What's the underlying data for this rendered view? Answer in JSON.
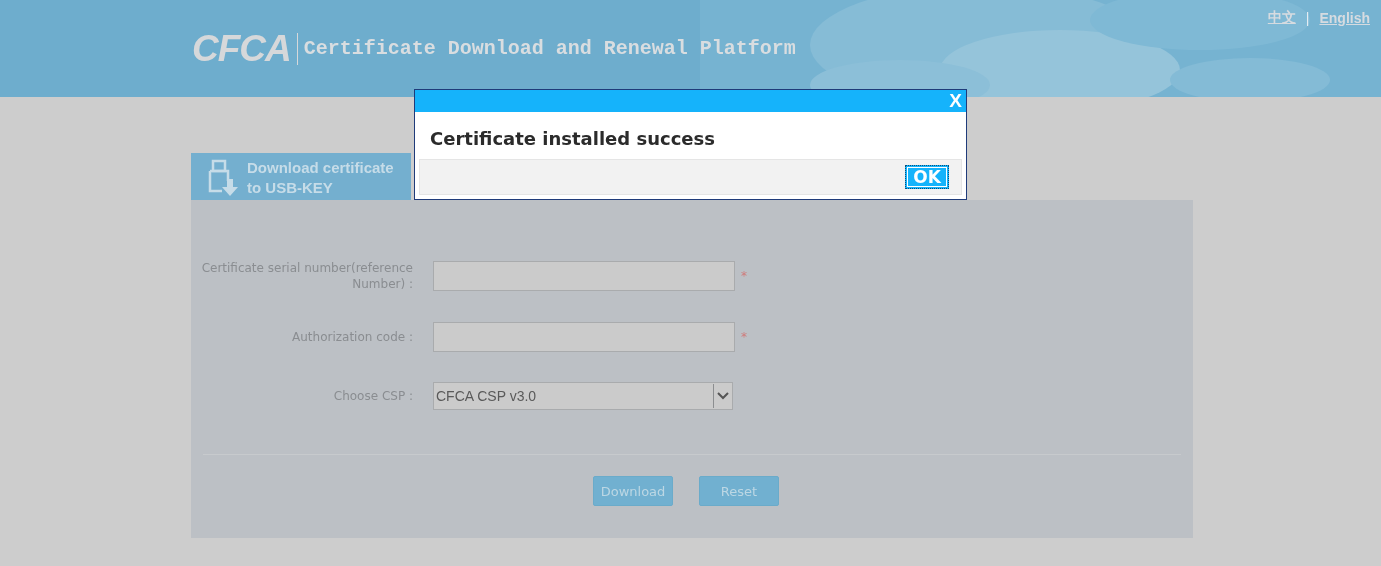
{
  "header": {
    "logo": "CFCA",
    "title": "Certificate Download and Renewal Platform",
    "languages": [
      "中文",
      "English"
    ],
    "separator": "|"
  },
  "tab": {
    "label": "Download certificate to USB-KEY"
  },
  "form": {
    "fields": [
      {
        "kind": "text",
        "label": "Certificate serial number(reference Number) :",
        "required_mark": "*"
      },
      {
        "kind": "text",
        "label": "Authorization code :",
        "required_mark": "*"
      },
      {
        "kind": "select",
        "label": "Choose CSP :",
        "value": "CFCA CSP v3.0"
      }
    ],
    "buttons": [
      "Download",
      "Reset"
    ]
  },
  "dialog": {
    "close": "X",
    "message": "Certificate installed success",
    "button": "OK"
  }
}
